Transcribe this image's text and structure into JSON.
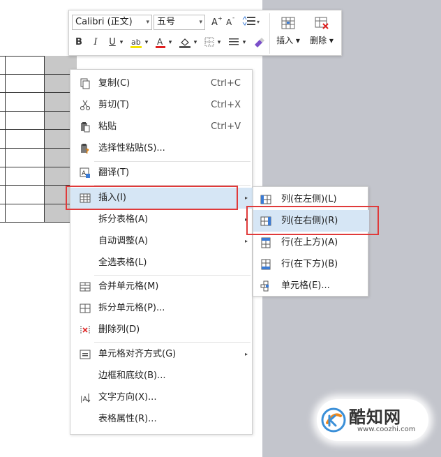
{
  "toolbar": {
    "font_name": "Calibri (正文)",
    "font_size": "五号",
    "bold": "B",
    "italic": "I",
    "underline": "U",
    "insert_label": "插入",
    "delete_label": "删除",
    "dropdown_arrow": "▾"
  },
  "context_menu": {
    "copy": {
      "label": "复制(C)",
      "shortcut": "Ctrl+C"
    },
    "cut": {
      "label": "剪切(T)",
      "shortcut": "Ctrl+X"
    },
    "paste": {
      "label": "粘贴",
      "shortcut": "Ctrl+V"
    },
    "paste_special": {
      "label": "选择性粘贴(S)..."
    },
    "translate": {
      "label": "翻译(T)"
    },
    "insert": {
      "label": "插入(I)"
    },
    "split_table": {
      "label": "拆分表格(A)"
    },
    "auto_fit": {
      "label": "自动调整(A)"
    },
    "select_table": {
      "label": "全选表格(L)"
    },
    "merge_cells": {
      "label": "合并单元格(M)"
    },
    "split_cells": {
      "label": "拆分单元格(P)..."
    },
    "delete_column": {
      "label": "删除列(D)"
    },
    "cell_alignment": {
      "label": "单元格对齐方式(G)"
    },
    "borders_shading": {
      "label": "边框和底纹(B)..."
    },
    "text_direction": {
      "label": "文字方向(X)..."
    },
    "table_properties": {
      "label": "表格属性(R)..."
    },
    "submenu_arrow": "▸"
  },
  "insert_submenu": {
    "col_left": {
      "label": "列(在左侧)(L)"
    },
    "col_right": {
      "label": "列(在右侧)(R)"
    },
    "row_above": {
      "label": "行(在上方)(A)"
    },
    "row_below": {
      "label": "行(在下方)(B)"
    },
    "cell": {
      "label": "单元格(E)..."
    }
  },
  "watermark": {
    "title": "酷知网",
    "url": "www.coozhi.com"
  },
  "colors": {
    "highlight": "#d6e6f5",
    "red_box": "#e03a3a",
    "gray_panel": "#c3c5cc"
  }
}
